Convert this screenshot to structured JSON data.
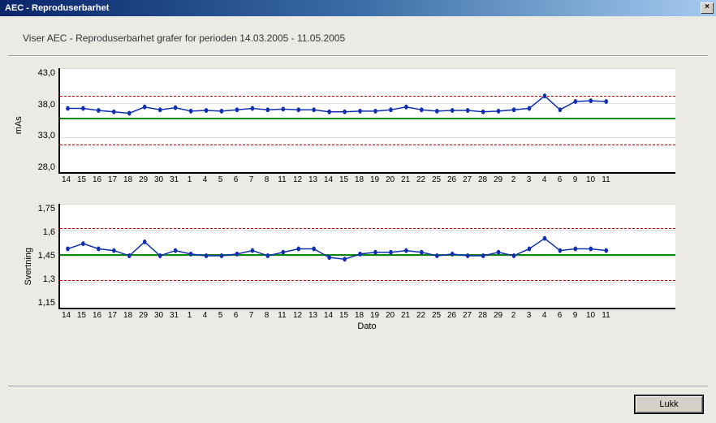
{
  "window": {
    "title": "AEC - Reproduserbarhet",
    "close_label": "×"
  },
  "subtitle": "Viser AEC - Reproduserbarhet grafer  for perioden 14.03.2005 - 11.05.2005",
  "footer": {
    "close_button": "Lukk"
  },
  "xlabel": "Dato",
  "categories": [
    "14",
    "15",
    "16",
    "17",
    "18",
    "29",
    "30",
    "31",
    "1",
    "4",
    "5",
    "6",
    "7",
    "8",
    "11",
    "12",
    "13",
    "14",
    "15",
    "18",
    "19",
    "20",
    "21",
    "22",
    "25",
    "26",
    "27",
    "28",
    "29",
    "2",
    "3",
    "4",
    "6",
    "9",
    "10",
    "11"
  ],
  "chart_data": [
    {
      "type": "line",
      "ylabel": "mAs",
      "yticks": [
        43.0,
        38.0,
        33.0,
        28.0
      ],
      "ylim": [
        28.0,
        43.0
      ],
      "ref_green": 35.8,
      "ref_red_upper": 39.0,
      "ref_red_lower": 32.0,
      "values": [
        37.2,
        37.2,
        36.9,
        36.7,
        36.5,
        37.4,
        37.0,
        37.3,
        36.8,
        36.9,
        36.8,
        37.0,
        37.2,
        37.0,
        37.1,
        37.0,
        37.0,
        36.7,
        36.7,
        36.8,
        36.8,
        37.0,
        37.4,
        37.0,
        36.8,
        36.9,
        36.9,
        36.7,
        36.8,
        37.0,
        37.2,
        39.0,
        37.0,
        38.2,
        38.3,
        38.2
      ]
    },
    {
      "type": "line",
      "ylabel": "Svertning",
      "yticks": [
        1.75,
        1.6,
        1.45,
        1.3,
        1.15
      ],
      "ylim": [
        1.15,
        1.75
      ],
      "ref_green": 1.46,
      "ref_red_upper": 1.61,
      "ref_red_lower": 1.31,
      "values": [
        1.49,
        1.52,
        1.49,
        1.48,
        1.45,
        1.53,
        1.45,
        1.48,
        1.46,
        1.45,
        1.45,
        1.46,
        1.48,
        1.45,
        1.47,
        1.49,
        1.49,
        1.44,
        1.43,
        1.46,
        1.47,
        1.47,
        1.48,
        1.47,
        1.45,
        1.46,
        1.45,
        1.45,
        1.47,
        1.45,
        1.49,
        1.55,
        1.48,
        1.49,
        1.49,
        1.48
      ]
    }
  ]
}
